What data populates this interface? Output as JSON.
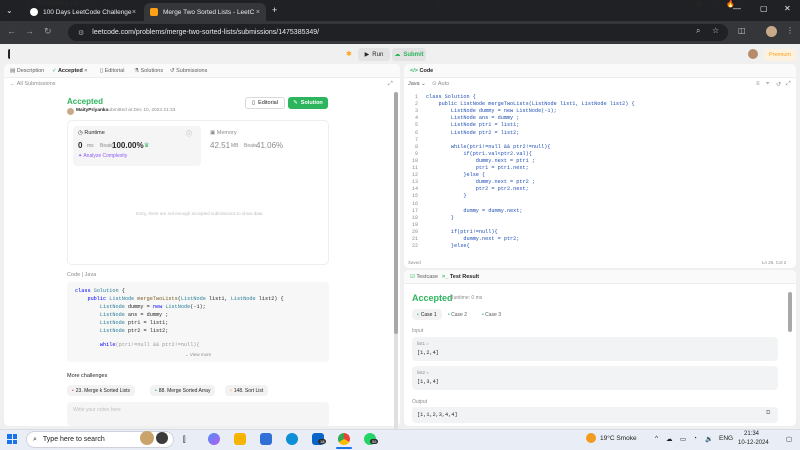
{
  "browser": {
    "tabs": [
      {
        "title": "100 Days LeetCode Challenge",
        "close": "×"
      },
      {
        "title": "Merge Two Sorted Lists - LeetC",
        "close": "×"
      }
    ],
    "new_tab": "+",
    "url": "leetcode.com/problems/merge-two-sorted-lists/submissions/1475385349/",
    "window_controls": {
      "minimize": "—",
      "maximize": "▢",
      "close": "✕"
    }
  },
  "topnav": {
    "problem_list": "Problem List",
    "run": "Run",
    "submit": "Submit",
    "notif_count": "0",
    "premium": "Premium"
  },
  "left": {
    "tabs": [
      "Description",
      "Accepted",
      "Editorial",
      "Solutions",
      "Submissions"
    ],
    "all_submissions": "All Submissions",
    "status": "Accepted",
    "author": "MaityPriyanka",
    "submitted": "submitted at Dec 10, 2024 21:33",
    "editorial_btn": "Editorial",
    "solution_btn": "Solution",
    "runtime_label": "Runtime",
    "runtime_value": "0",
    "runtime_unit": "ms",
    "beats_label": "Beats",
    "runtime_beats": "100.00%",
    "analyze": "Analyze Complexity",
    "memory_label": "Memory",
    "memory_value": "42.51",
    "memory_unit": "MB",
    "memory_beats": "41.06%",
    "no_data": "Sorry, there are not enough accepted submissions to show data",
    "code_label": "Code",
    "lang": "Java",
    "code_lines": [
      "class Solution {",
      "    public ListNode mergeTwoLists(ListNode list1, ListNode list2) {",
      "        ListNode dummy = new ListNode(-1);",
      "        ListNode ans = dummy ;",
      "        ListNode ptr1 = list1;",
      "        ListNode ptr2 = list2;",
      "",
      "        while(ptr1!=null && ptr2!=null){"
    ],
    "view_more": "View more",
    "more_challenges": "More challenges",
    "challenges": [
      "23. Merge k Sorted Lists",
      "88. Merge Sorted Array",
      "148. Sort List"
    ],
    "notes_placeholder": "Write your notes here"
  },
  "editor": {
    "title": "Code",
    "lang": "Java",
    "mode": "Auto",
    "line_numbers": [
      "1",
      "2",
      "3",
      "4",
      "5",
      "6",
      "7",
      "8",
      "9",
      "10",
      "11",
      "12",
      "13",
      "14",
      "15",
      "16",
      "17",
      "18",
      "19",
      "20",
      "21",
      "22"
    ],
    "lines": [
      "class Solution {",
      "    public ListNode mergeTwoLists(ListNode list1, ListNode list2) {",
      "        ListNode dummy = new ListNode(-1);",
      "        ListNode ans = dummy ;",
      "        ListNode ptr1 = list1;",
      "        ListNode ptr2 = list2;",
      "",
      "        while(ptr1!=null && ptr2!=null){",
      "            if(ptr1.val<ptr2.val){",
      "                dummy.next = ptr1 ;",
      "                ptr1 = ptr1.next;",
      "            }else {",
      "                dummy.next = ptr2 ;",
      "                ptr2 = ptr2.next;",
      "            }",
      "",
      "            dummy = dummy.next;",
      "        }",
      "",
      "        if(ptr1!=null){",
      "            dummy.next = ptr2;",
      "        }else{"
    ],
    "saved": "Saved",
    "cursor": "Ln 26, Col 2"
  },
  "result": {
    "tabs": [
      "Testcase",
      "Test Result"
    ],
    "status": "Accepted",
    "runtime": "Runtime: 0 ms",
    "cases": [
      "Case 1",
      "Case 2",
      "Case 3"
    ],
    "input_label": "Input",
    "list1_label": "list1 =",
    "list1_value": "[1,2,4]",
    "list2_label": "list2 =",
    "list2_value": "[1,3,4]",
    "output_label": "Output",
    "output_value": "[1,1,2,3,4,4]"
  },
  "taskbar": {
    "search": "Type here to search",
    "weather": "19°C  Smoke",
    "lang": "ENG",
    "time": "21:34",
    "date": "10-12-2024",
    "badge1": "18",
    "badge2": "55"
  },
  "colors": {
    "accent_green": "#2db55d",
    "premium_orange": "#ffa116",
    "chrome_dark": "#202124"
  }
}
